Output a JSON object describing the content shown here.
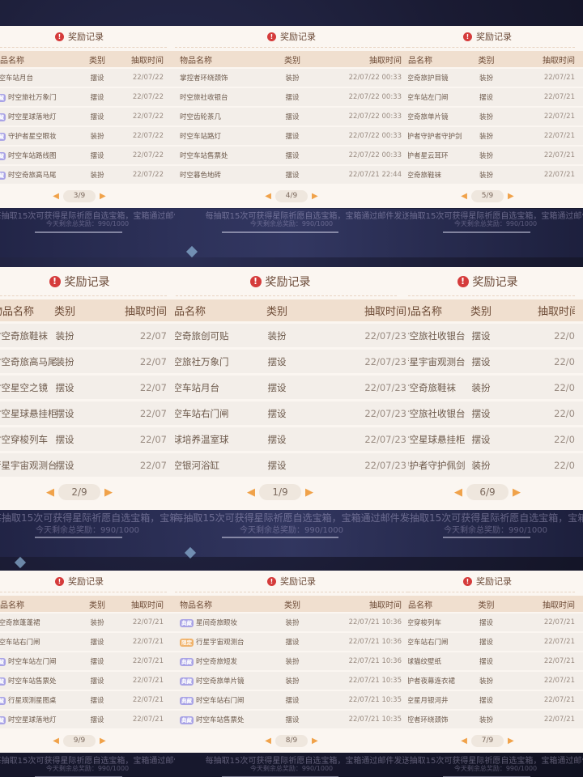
{
  "page": {
    "title": "奖励记录",
    "headers": {
      "name": "物品名称",
      "type": "类别",
      "time": "抽取时间"
    },
    "tags": {
      "purple": "典藏",
      "orange": "限定"
    },
    "ticker": "每抽取15次可获得星际祈愿自选宝箱，宝箱通过邮件发送",
    "remaining": "今天剩余总奖励：990/1000",
    "colors": {
      "panel": "#fbf6f1",
      "header": "#f0dfcf",
      "accent": "#f0a24a",
      "tag_purple": "#a9a3e6",
      "tag_orange": "#f0b168"
    }
  },
  "tiles": [
    {
      "pager": "3/9",
      "rows": [
        {
          "name": "时空车站月台",
          "type": "摆设",
          "time": "22/07/22",
          "tag": ""
        },
        {
          "name": "时空旅社万象门",
          "type": "摆设",
          "time": "22/07/22",
          "tag": "purple"
        },
        {
          "name": "时空星球落地灯",
          "type": "摆设",
          "time": "22/07/22",
          "tag": "purple"
        },
        {
          "name": "守护者星空眼妆",
          "type": "装扮",
          "time": "22/07/22",
          "tag": "purple"
        },
        {
          "name": "时空车站路线图",
          "type": "摆设",
          "time": "22/07/22",
          "tag": "purple"
        },
        {
          "name": "时空奇旅高马尾",
          "type": "装扮",
          "time": "22/07/22",
          "tag": "purple"
        }
      ]
    },
    {
      "pager": "4/9",
      "rows": [
        {
          "name": "掌控者环绕颈饰",
          "type": "装扮",
          "time": "22/07/22 00:33",
          "tag": ""
        },
        {
          "name": "时空旅社收银台",
          "type": "摆设",
          "time": "22/07/22 00:33",
          "tag": ""
        },
        {
          "name": "时空齿轮茶几",
          "type": "摆设",
          "time": "22/07/22 00:33",
          "tag": ""
        },
        {
          "name": "时空车站路灯",
          "type": "摆设",
          "time": "22/07/22 00:33",
          "tag": ""
        },
        {
          "name": "时空车站售票处",
          "type": "摆设",
          "time": "22/07/22 00:33",
          "tag": ""
        },
        {
          "name": "时空暮色地砖",
          "type": "摆设",
          "time": "22/07/21 22:44",
          "tag": ""
        }
      ]
    },
    {
      "pager": "5/9",
      "rows": [
        {
          "name": "时空奇旅护目镜",
          "type": "装扮",
          "time": "22/07/21",
          "tag": ""
        },
        {
          "name": "时空车站左门闸",
          "type": "摆设",
          "time": "22/07/21",
          "tag": ""
        },
        {
          "name": "时空奇旅单片镜",
          "type": "装扮",
          "time": "22/07/21",
          "tag": ""
        },
        {
          "name": "守护者守护者守护剑",
          "type": "装扮",
          "time": "22/07/21",
          "tag": ""
        },
        {
          "name": "守护者星云耳环",
          "type": "装扮",
          "time": "22/07/21",
          "tag": ""
        },
        {
          "name": "时空奇旅鞋袜",
          "type": "装扮",
          "time": "22/07/21",
          "tag": ""
        }
      ]
    },
    {
      "pager": "2/9",
      "rows": [
        {
          "name": "时空奇旅鞋袜",
          "type": "装扮",
          "time": "22/07",
          "tag": ""
        },
        {
          "name": "时空奇旅高马尾",
          "type": "装扮",
          "time": "22/07",
          "tag": ""
        },
        {
          "name": "时空星空之镜",
          "type": "摆设",
          "time": "22/07",
          "tag": ""
        },
        {
          "name": "时空星球悬挂柜",
          "type": "摆设",
          "time": "22/07",
          "tag": ""
        },
        {
          "name": "时空穿梭列车",
          "type": "摆设",
          "time": "22/07",
          "tag": ""
        },
        {
          "name": "行星宇宙观测台",
          "type": "摆设",
          "time": "22/07",
          "tag": ""
        }
      ]
    },
    {
      "pager": "1/9",
      "rows": [
        {
          "name": "时空奇旅创可贴",
          "type": "装扮",
          "time": "22/07/23",
          "tag": ""
        },
        {
          "name": "时空旅社万象门",
          "type": "摆设",
          "time": "22/07/23",
          "tag": ""
        },
        {
          "name": "时空车站月台",
          "type": "摆设",
          "time": "22/07/23",
          "tag": ""
        },
        {
          "name": "时空车站右门闸",
          "type": "摆设",
          "time": "22/07/23",
          "tag": ""
        },
        {
          "name": "星球培养温室球",
          "type": "摆设",
          "time": "22/07/23",
          "tag": ""
        },
        {
          "name": "时空银河浴缸",
          "type": "摆设",
          "time": "22/07/23",
          "tag": ""
        }
      ]
    },
    {
      "pager": "6/9",
      "rows": [
        {
          "name": "时空旅社收银台",
          "type": "摆设",
          "time": "22/0",
          "tag": ""
        },
        {
          "name": "行星宇宙观测台",
          "type": "摆设",
          "time": "22/0",
          "tag": ""
        },
        {
          "name": "时空奇旅鞋袜",
          "type": "装扮",
          "time": "22/0",
          "tag": ""
        },
        {
          "name": "时空旅社收银台",
          "type": "摆设",
          "time": "22/0",
          "tag": ""
        },
        {
          "name": "时空星球悬挂柜",
          "type": "摆设",
          "time": "22/0",
          "tag": ""
        },
        {
          "name": "守护者守护佩剑",
          "type": "装扮",
          "time": "22/0",
          "tag": ""
        }
      ]
    },
    {
      "pager": "9/9",
      "rows": [
        {
          "name": "时空奇旅蓬蓬裙",
          "type": "装扮",
          "time": "22/07/21",
          "tag": ""
        },
        {
          "name": "时空车站右门闸",
          "type": "摆设",
          "time": "22/07/21",
          "tag": ""
        },
        {
          "name": "时空车站左门闸",
          "type": "摆设",
          "time": "22/07/21",
          "tag": "purple"
        },
        {
          "name": "时空车站售票处",
          "type": "摆设",
          "time": "22/07/21",
          "tag": "purple"
        },
        {
          "name": "行星观测星图桌",
          "type": "摆设",
          "time": "22/07/21",
          "tag": "purple"
        },
        {
          "name": "时空星球落地灯",
          "type": "摆设",
          "time": "22/07/21",
          "tag": "purple"
        }
      ]
    },
    {
      "pager": "8/9",
      "rows": [
        {
          "name": "星间奇旅眼妆",
          "type": "装扮",
          "time": "22/07/21 10:36",
          "tag": "purple"
        },
        {
          "name": "行星宇宙观测台",
          "type": "摆设",
          "time": "22/07/21 10:36",
          "tag": "orange"
        },
        {
          "name": "时空奇旅短发",
          "type": "装扮",
          "time": "22/07/21 10:36",
          "tag": "purple"
        },
        {
          "name": "时空奇旅单片镜",
          "type": "装扮",
          "time": "22/07/21 10:35",
          "tag": "purple"
        },
        {
          "name": "时空车站右门闸",
          "type": "摆设",
          "time": "22/07/21 10:35",
          "tag": "purple"
        },
        {
          "name": "时空车站售票处",
          "type": "摆设",
          "time": "22/07/21 10:35",
          "tag": "purple"
        }
      ]
    },
    {
      "pager": "7/9",
      "rows": [
        {
          "name": "时空穿梭列车",
          "type": "摆设",
          "time": "22/07/21",
          "tag": ""
        },
        {
          "name": "时空车站右门闸",
          "type": "摆设",
          "time": "22/07/21",
          "tag": ""
        },
        {
          "name": "星球猫纹壁纸",
          "type": "摆设",
          "time": "22/07/21",
          "tag": ""
        },
        {
          "name": "守护者夜幕连衣裙",
          "type": "装扮",
          "time": "22/07/21",
          "tag": ""
        },
        {
          "name": "时空星月银河井",
          "type": "摆设",
          "time": "22/07/21",
          "tag": ""
        },
        {
          "name": "掌控者环绕颈饰",
          "type": "装扮",
          "time": "22/07/21",
          "tag": ""
        }
      ]
    }
  ]
}
